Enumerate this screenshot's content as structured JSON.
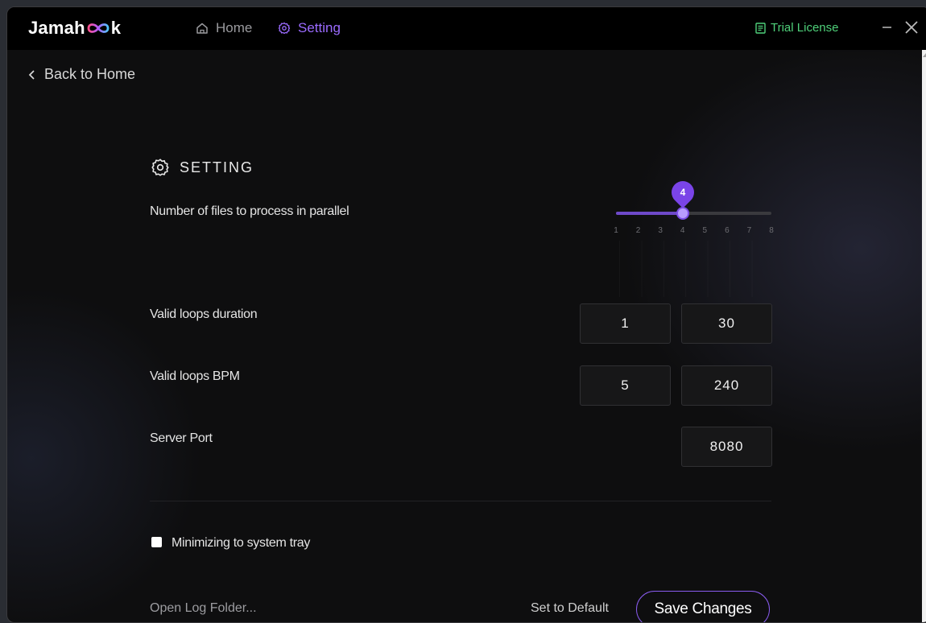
{
  "app": {
    "logo_left": "Jamah",
    "logo_right": "k",
    "logo_icon": "infinity-icon",
    "license_label": "Trial License"
  },
  "nav": {
    "home_label": "Home",
    "setting_label": "Setting"
  },
  "window_controls": {
    "minimize_icon": "minimize-icon",
    "close_icon": "close-icon"
  },
  "back_label": "Back to Home",
  "setting": {
    "title": "SETTING",
    "parallel": {
      "label": "Number of files to process in parallel",
      "value": 4,
      "value_text": "4",
      "min": 1,
      "max": 8,
      "ticks": [
        "1",
        "2",
        "3",
        "4",
        "5",
        "6",
        "7",
        "8"
      ]
    },
    "duration": {
      "label": "Valid loops duration",
      "min": "1",
      "max": "30"
    },
    "bpm": {
      "label": "Valid loops BPM",
      "min": "5",
      "max": "240"
    },
    "port": {
      "label": "Server Port",
      "value": "8080"
    },
    "tray": {
      "label": "Minimizing to system tray",
      "checked": false
    }
  },
  "footer": {
    "open_log": "Open Log Folder...",
    "set_default": "Set to Default",
    "save": "Save Changes"
  },
  "colors": {
    "accent": "#8a5cf0",
    "license": "#4fd17a",
    "background": "#0e0e0f"
  }
}
